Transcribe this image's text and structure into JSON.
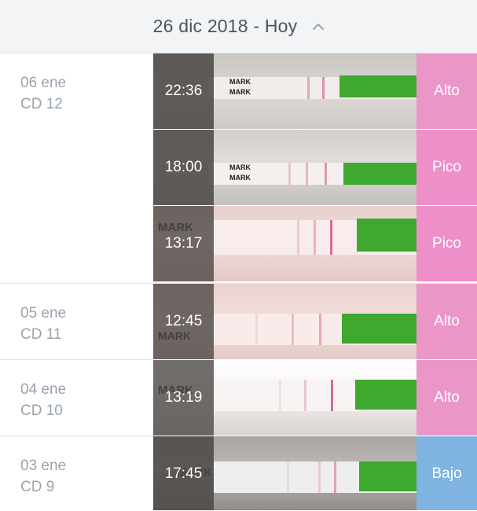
{
  "header": {
    "title": "26 dic 2018 - Hoy",
    "chevron_icon": "chevron-up-icon"
  },
  "days": [
    {
      "date": "06 ene",
      "cycle_day": "CD 12",
      "entries": [
        {
          "time": "22:36",
          "level": "Alto",
          "level_color": "#ea97c8"
        },
        {
          "time": "18:00",
          "level": "Pico",
          "level_color": "#ef8fc9"
        },
        {
          "time": "13:17",
          "level": "Pico",
          "level_color": "#ef8fc9"
        }
      ]
    },
    {
      "date": "05 ene",
      "cycle_day": "CD 11",
      "entries": [
        {
          "time": "12:45",
          "level": "Alto",
          "level_color": "#ea97c8"
        }
      ]
    },
    {
      "date": "04 ene",
      "cycle_day": "CD 10",
      "entries": [
        {
          "time": "13:19",
          "level": "Alto",
          "level_color": "#ea97c8"
        }
      ]
    },
    {
      "date": "03 ene",
      "cycle_day": "CD 9",
      "entries": [
        {
          "time": "17:45",
          "level": "Bajo",
          "level_color": "#7fb3e0"
        }
      ]
    }
  ],
  "strip_mark_text": "MARK",
  "colors": {
    "header_bg": "#f3f4f6",
    "label_gray": "#9aa3ad",
    "test_green": "#3fa82f",
    "test_line": "#d9608e"
  }
}
